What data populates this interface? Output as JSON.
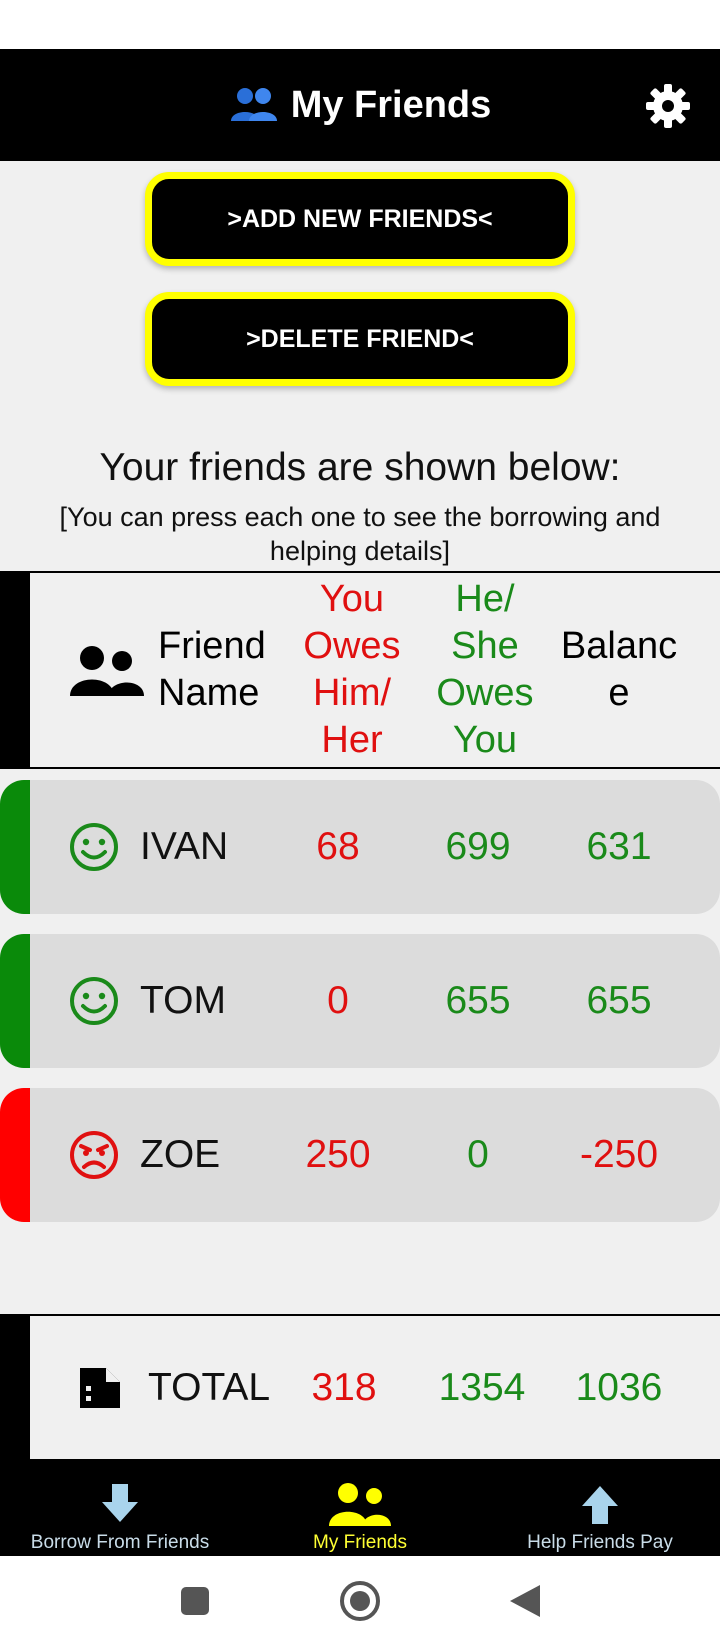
{
  "app": {
    "title": "My Friends",
    "title_icon": "people-icon",
    "settings_icon": "gear-icon"
  },
  "buttons": {
    "add": ">ADD NEW FRIENDS<",
    "delete": ">DELETE FRIEND<"
  },
  "intro": {
    "heading": "Your friends are shown below:",
    "subheading": "[You can press each one to see the borrowing and helping details]"
  },
  "table": {
    "headers": {
      "name": [
        "Friend",
        "Name"
      ],
      "you_owe": [
        "You",
        "Owes",
        "Him/",
        "Her"
      ],
      "they_owe": [
        "He/",
        "She",
        "Owes",
        "You"
      ],
      "balance": [
        "Balanc",
        "e"
      ]
    },
    "rows": [
      {
        "name": "IVAN",
        "you_owe": "68",
        "they_owe": "699",
        "balance": "631",
        "mood": "smile-icon",
        "status_color": "#0a8a0a",
        "balance_color": "#1a8a1a"
      },
      {
        "name": "TOM",
        "you_owe": "0",
        "they_owe": "655",
        "balance": "655",
        "mood": "smile-icon",
        "status_color": "#0a8a0a",
        "balance_color": "#1a8a1a"
      },
      {
        "name": "ZOE",
        "you_owe": "250",
        "they_owe": "0",
        "balance": "-250",
        "mood": "angry-face-icon",
        "status_color": "#ff0000",
        "balance_color": "#e01010"
      }
    ],
    "total": {
      "label": "TOTAL",
      "you_owe": "318",
      "they_owe": "1354",
      "balance": "1036",
      "icon": "document-icon"
    }
  },
  "nav": [
    {
      "label": "Borrow From Friends",
      "icon": "arrow-down-icon",
      "active": false
    },
    {
      "label": "My Friends",
      "icon": "people-icon",
      "active": true
    },
    {
      "label": "Help Friends Pay",
      "icon": "arrow-up-icon",
      "active": false
    }
  ],
  "colors": {
    "accent_yellow": "#ffff00",
    "red": "#e01010",
    "green": "#1a8a1a",
    "nav_light_blue": "#c9dce8"
  }
}
